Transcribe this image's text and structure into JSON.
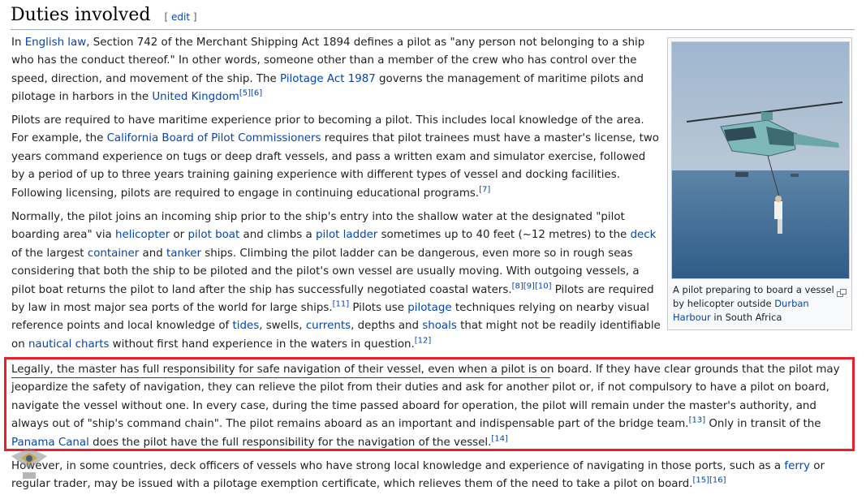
{
  "section": {
    "title": "Duties involved",
    "edit_open": "[ ",
    "edit_label": "edit",
    "edit_close": " ]"
  },
  "p1": {
    "t1": "In ",
    "l1": "English law",
    "t2": ", Section 742 of the Merchant Shipping Act 1894 defines a pilot as \"any person not belonging to a ship who has the conduct thereof.\" In other words, someone other than a member of the crew who has control over the speed, direction, and movement of the ship. The ",
    "l2": "Pilotage Act 1987",
    "t3": " governs the management of maritime pilots and pilotage in harbors in the ",
    "l3": "United Kingdom",
    "r1": "[5]",
    "r2": "[6]"
  },
  "p2": {
    "t1": "Pilots are required to have maritime experience prior to becoming a pilot. This includes local knowledge of the area. For example, the ",
    "l1": "California Board of Pilot Commissioners",
    "t2": " requires that pilot trainees must have a master's license, two years command experience on tugs or deep draft vessels, and pass a written exam and simulator exercise, followed by a period of up to three years training gaining experience with different types of vessel and docking facilities. Following licensing, pilots are required to engage in continuing educational programs.",
    "r1": "[7]"
  },
  "p3": {
    "t1": "Normally, the pilot joins an incoming ship prior to the ship's entry into the shallow water at the designated \"pilot boarding area\" via ",
    "l1": "helicopter",
    "t2": " or ",
    "l2": "pilot boat",
    "t3": " and climbs a ",
    "l3": "pilot ladder",
    "t4": " sometimes up to 40 feet (~12 metres) to the ",
    "l4": "deck",
    "t5": " of the largest ",
    "l5": "container",
    "t6": " and ",
    "l6": "tanker",
    "t7": " ships. Climbing the pilot ladder can be dangerous, even more so in rough seas considering that both the ship to be piloted and the pilot's own vessel are usually moving. With outgoing vessels, a pilot boat returns the pilot to land after the ship has successfully negotiated coastal waters.",
    "r1": "[8]",
    "r2": "[9]",
    "r3": "[10]",
    "t8": " Pilots are required by law in most major sea ports of the world for large ships.",
    "r4": "[11]",
    "t9": " Pilots use ",
    "l7": "pilotage",
    "t10": " techniques relying on nearby visual reference points and local knowledge of ",
    "l8": "tides",
    "t11": ", swells, ",
    "l9": "currents",
    "t12": ", depths and ",
    "l10": "shoals",
    "t13": " that might not be readily identifiable on ",
    "l11": "nautical charts",
    "t14": " without first hand experience in the waters in question.",
    "r5": "[12]"
  },
  "p4": {
    "t1": "Legally, the master has full responsibility for safe navigation of their vessel, even when a pilot is on board.",
    "t2": " If they have clear grounds that the pilot may jeopardize the safety of navigation, they can relieve the pilot from their duties and ask for another pilot or, if not compulsory to have a pilot on board, navigate the vessel without one. In every case, during the time passed aboard for operation, the pilot will remain under the master's authority, and always out of \"ship's command chain\". The pilot remains aboard as an important and indispensable part of the bridge team.",
    "r1": "[13]",
    "t3": " Only in transit of the ",
    "l1": "Panama Canal",
    "t4": " does the pilot have the full responsibility for the navigation of the vessel.",
    "r2": "[14]"
  },
  "p5": {
    "t1": "However, in some countries, deck officers of vessels who have strong local knowledge and experience of navigating in those ports, such as a ",
    "l1": "ferry",
    "t2": " or regular trader, may be issued with a pilotage exemption certificate, which relieves them of the need to take a pilot on board.",
    "r1": "[15]",
    "r2": "[16]"
  },
  "thumb": {
    "caption1": "A pilot preparing to board a vessel by helicopter outside ",
    "caption_link": "Durban Harbour",
    "caption2": " in South Africa",
    "magnify_icon": "magnify-icon"
  },
  "colors": {
    "link": "#0645ad",
    "highlight_border": "#e8202a",
    "sky": "#8fa8c4",
    "sea": "#3d6a93"
  }
}
